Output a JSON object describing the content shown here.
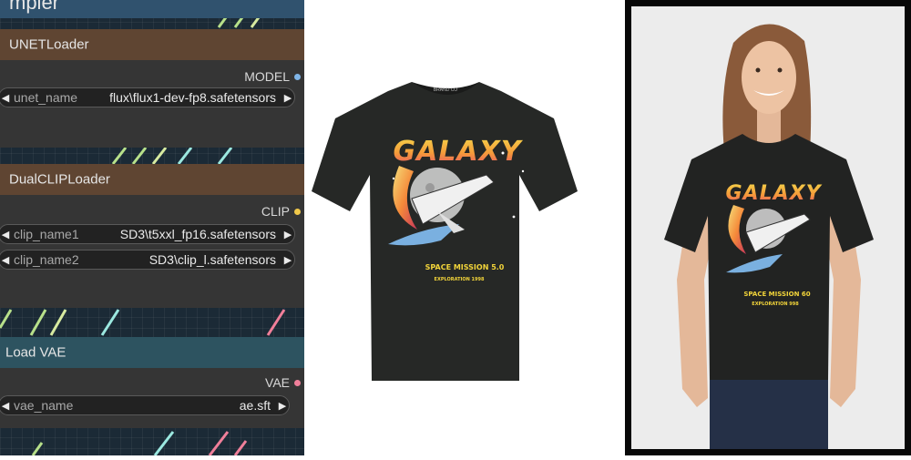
{
  "canvas": {
    "top_fragment": "mpler",
    "nodes": [
      {
        "title": "UNETLoader",
        "output": {
          "label": "MODEL",
          "color": "#7fb5e8"
        },
        "widgets": [
          {
            "name": "unet_name",
            "value": "flux\\flux1-dev-fp8.safetensors"
          }
        ]
      },
      {
        "title": "DualCLIPLoader",
        "output": {
          "label": "CLIP",
          "color": "#f0c84a"
        },
        "widgets": [
          {
            "name": "clip_name1",
            "value": "SD3\\t5xxl_fp16.safetensors"
          },
          {
            "name": "clip_name2",
            "value": "SD3\\clip_l.safetensors"
          }
        ]
      },
      {
        "title": "Load VAE",
        "output": {
          "label": "VAE",
          "color": "#f07f9a"
        },
        "widgets": [
          {
            "name": "vae_name",
            "value": "ae.sft"
          }
        ]
      }
    ]
  },
  "product": {
    "flat": {
      "neck_label": "BRAND CO",
      "graphic": {
        "title": "GALAXY",
        "line1": "SPACE MISSION 5.0",
        "line2": "EXPLORATION 1998"
      }
    },
    "model": {
      "graphic": {
        "title": "GALAXY",
        "line1": "SPACE MISSION 60",
        "line2": "EXPLORATION 998"
      }
    }
  }
}
